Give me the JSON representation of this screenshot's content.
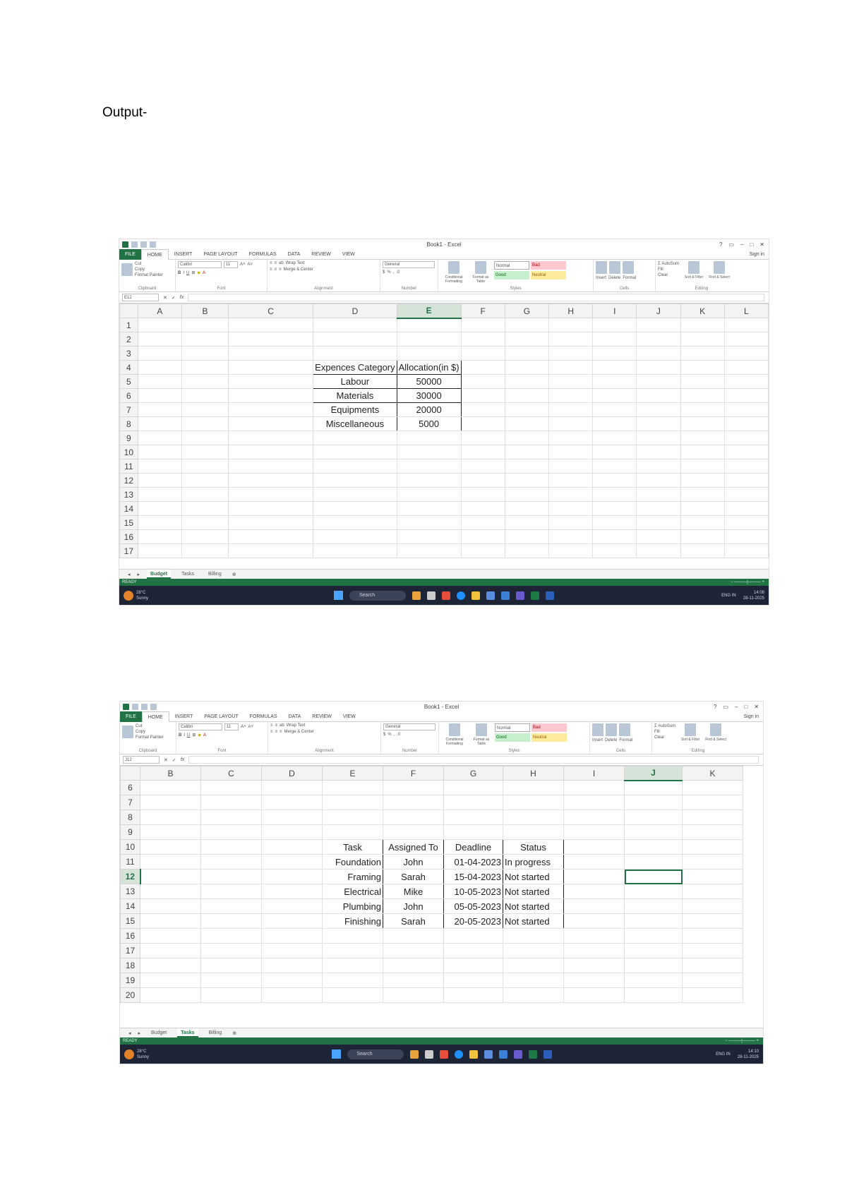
{
  "heading": "Output-",
  "screens": [
    {
      "title": "Book1 - Excel",
      "menu": [
        "FILE",
        "HOME",
        "INSERT",
        "PAGE LAYOUT",
        "FORMULAS",
        "DATA",
        "REVIEW",
        "VIEW"
      ],
      "sign_in": "Sign in",
      "ribbon": {
        "clipboard": [
          "Cut",
          "Copy",
          "Format Painter"
        ],
        "paste": "Paste",
        "font_name": "Calibri",
        "font_size": "11",
        "wrap_text": "Wrap Text",
        "merge_center": "Merge & Center",
        "number_format": "General",
        "conditional_formatting": "Conditional Formatting",
        "format_as_table": "Format as Table",
        "styles": [
          "Normal",
          "Bad",
          "Good",
          "Neutral"
        ],
        "cells": [
          "Insert",
          "Delete",
          "Format"
        ],
        "editing": [
          "AutoSum",
          "Fill",
          "Clear",
          "Sort & Filter",
          "Find & Select"
        ],
        "group_labels": [
          "Clipboard",
          "Font",
          "Alignment",
          "Number",
          "Styles",
          "Cells",
          "Editing"
        ]
      },
      "name_box": "E12",
      "columns": [
        "A",
        "B",
        "C",
        "D",
        "E",
        "F",
        "G",
        "H",
        "I",
        "J",
        "K",
        "L"
      ],
      "selected_column": "E",
      "rows": [
        "1",
        "2",
        "3",
        "4",
        "5",
        "6",
        "7",
        "8",
        "9",
        "10",
        "11",
        "12",
        "13",
        "14",
        "15",
        "16",
        "17"
      ],
      "table": {
        "headers": [
          "Expences Category",
          "Allocation(in $)"
        ],
        "rows": [
          [
            "Labour",
            "50000"
          ],
          [
            "Materials",
            "30000"
          ],
          [
            "Equipments",
            "20000"
          ],
          [
            "Miscellaneous",
            "5000"
          ]
        ]
      },
      "sheets": [
        "Budget",
        "Tasks",
        "Billing"
      ],
      "active_sheet": "Budget",
      "status": "READY",
      "taskbar": {
        "weather_temp": "28°C",
        "weather_text": "Sunny",
        "search": "Search",
        "lang": "ENG IN",
        "time": "14:08",
        "date": "28-11-2025"
      }
    },
    {
      "title": "Book1 - Excel",
      "menu": [
        "FILE",
        "HOME",
        "INSERT",
        "PAGE LAYOUT",
        "FORMULAS",
        "DATA",
        "REVIEW",
        "VIEW"
      ],
      "sign_in": "Sign in",
      "ribbon": {
        "clipboard": [
          "Cut",
          "Copy",
          "Format Painter"
        ],
        "paste": "Paste",
        "font_name": "Calibri",
        "font_size": "11",
        "wrap_text": "Wrap Text",
        "merge_center": "Merge & Center",
        "number_format": "General",
        "conditional_formatting": "Conditional Formatting",
        "format_as_table": "Format as Table",
        "styles": [
          "Normal",
          "Bad",
          "Good",
          "Neutral"
        ],
        "cells": [
          "Insert",
          "Delete",
          "Format"
        ],
        "editing": [
          "AutoSum",
          "Fill",
          "Clear",
          "Sort & Filter",
          "Find & Select"
        ],
        "group_labels": [
          "Clipboard",
          "Font",
          "Alignment",
          "Number",
          "Styles",
          "Cells",
          "Editing"
        ]
      },
      "name_box": "J12",
      "columns": [
        "B",
        "C",
        "D",
        "E",
        "F",
        "G",
        "H",
        "I",
        "J",
        "K"
      ],
      "selected_column": "J",
      "rows": [
        "6",
        "7",
        "8",
        "9",
        "10",
        "11",
        "12",
        "13",
        "14",
        "15",
        "16",
        "17",
        "18",
        "19",
        "20"
      ],
      "selected_row": "12",
      "table": {
        "headers": [
          "Task",
          "Assigned To",
          "Deadline",
          "Status"
        ],
        "rows": [
          [
            "Foundation",
            "John",
            "01-04-2023",
            "In progress"
          ],
          [
            "Framing",
            "Sarah",
            "15-04-2023",
            "Not started"
          ],
          [
            "Electrical",
            "Mike",
            "10-05-2023",
            "Not started"
          ],
          [
            "Plumbing",
            "John",
            "05-05-2023",
            "Not started"
          ],
          [
            "Finishing",
            "Sarah",
            "20-05-2023",
            "Not started"
          ]
        ]
      },
      "sheets": [
        "Budget",
        "Tasks",
        "Billing"
      ],
      "active_sheet": "Tasks",
      "status": "READY",
      "taskbar": {
        "weather_temp": "28°C",
        "weather_text": "Sunny",
        "search": "Search",
        "lang": "ENG IN",
        "time": "14:10",
        "date": "28-11-2025"
      }
    }
  ]
}
